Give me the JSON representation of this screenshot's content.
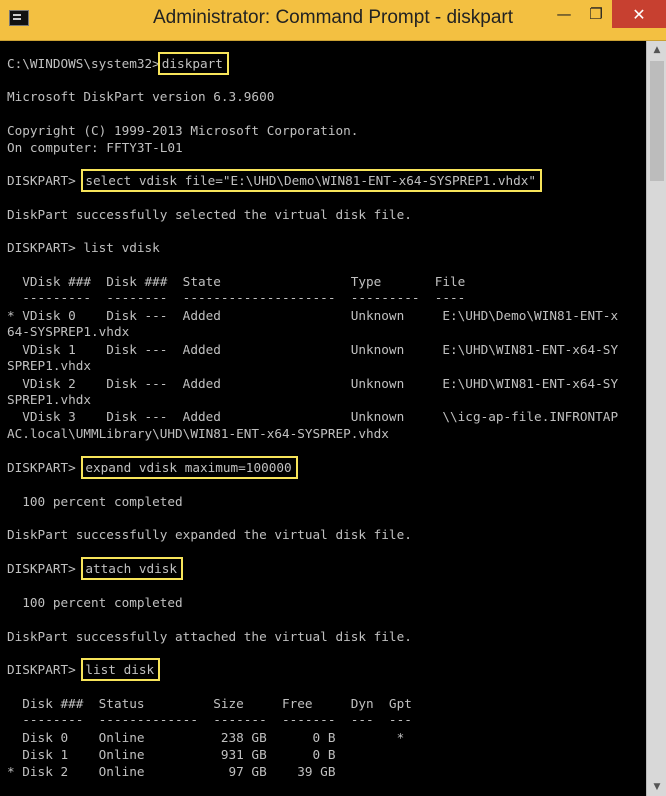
{
  "window": {
    "title": "Administrator: Command Prompt - diskpart",
    "icon": "cmd-icon",
    "controls": {
      "minimize": "—",
      "maximize": "❐",
      "close": "✕"
    }
  },
  "console": {
    "lines": [
      "C:\\WINDOWS\\system32>",
      "Microsoft DiskPart version 6.3.9600",
      "Copyright (C) 1999-2013 Microsoft Corporation.",
      "On computer: FFTY3T-L01",
      "DISKPART> ",
      "DiskPart successfully selected the virtual disk file.",
      "DISKPART> list vdisk",
      "  VDisk ###  Disk ###  State                 Type       File",
      "  ---------  --------  --------------------  ---------  ----",
      "* VDisk 0    Disk ---  Added                 Unknown     E:\\UHD\\Demo\\WIN81-ENT-x",
      "64-SYSPREP1.vhdx",
      "  VDisk 1    Disk ---  Added                 Unknown     E:\\UHD\\WIN81-ENT-x64-SY",
      "SPREP1.vhdx",
      "  VDisk 2    Disk ---  Added                 Unknown     E:\\UHD\\WIN81-ENT-x64-SY",
      "SPREP1.vhdx",
      "  VDisk 3    Disk ---  Added                 Unknown     \\\\icg-ap-file.INFRONTAP",
      "AC.local\\UMMLibrary\\UHD\\WIN81-ENT-x64-SYSPREP.vhdx",
      "DISKPART> ",
      "  100 percent completed",
      "DiskPart successfully expanded the virtual disk file.",
      "DISKPART> ",
      "  100 percent completed",
      "DiskPart successfully attached the virtual disk file.",
      "DISKPART> ",
      "  Disk ###  Status         Size     Free     Dyn  Gpt",
      "  --------  -------------  -------  -------  ---  ---",
      "  Disk 0    Online          238 GB      0 B        *",
      "  Disk 1    Online          931 GB      0 B",
      "* Disk 2    Online           97 GB    39 GB"
    ],
    "commands": {
      "diskpart": "diskpart",
      "select": "select vdisk file=\"E:\\UHD\\Demo\\WIN81-ENT-x64-SYSPREP1.vhdx\"",
      "expand": "expand vdisk maximum=100000",
      "attach": "attach vdisk",
      "list_disk": "list disk"
    }
  },
  "colors": {
    "titlebar": "#f3c041",
    "console_bg": "#000000",
    "console_text": "#c0c0c0",
    "highlight": "#f7e45a",
    "close": "#c74030"
  }
}
